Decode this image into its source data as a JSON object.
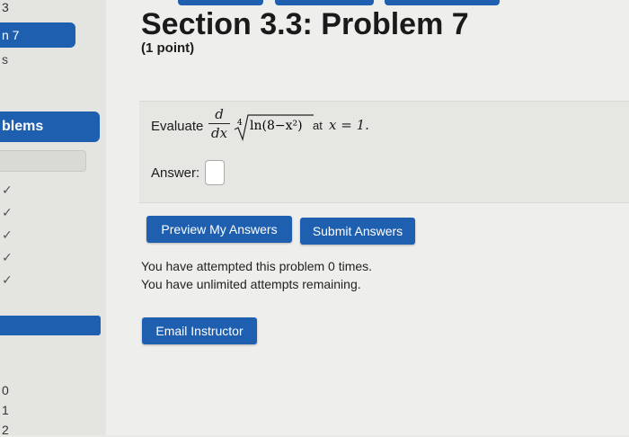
{
  "sidebar": {
    "partial_top_number": "3",
    "problem_item": "n 7",
    "s_text": "s",
    "problems_heading": "blems",
    "checks": [
      "✓",
      "✓",
      "✓",
      "✓",
      "✓"
    ],
    "numbers": [
      "0",
      "1",
      "2"
    ]
  },
  "header": {
    "title": "Section 3.3: Problem 7",
    "points": "(1 point)"
  },
  "problem": {
    "evaluate_label": "Evaluate",
    "derivative_num": "d",
    "derivative_den": "dx",
    "radical_index": "4",
    "radicand": "ln(8−x²)",
    "at_label": "at",
    "at_expr": "x = 1."
  },
  "answer": {
    "label": "Answer:",
    "value": ""
  },
  "buttons": {
    "preview": "Preview My Answers",
    "submit": "Submit Answers",
    "email": "Email Instructor"
  },
  "messages": {
    "attempted": "You have attempted this problem 0 times.",
    "unlimited": "You have unlimited attempts remaining."
  },
  "colors": {
    "accent": "#1e5fb0",
    "background": "#eeeeec"
  }
}
